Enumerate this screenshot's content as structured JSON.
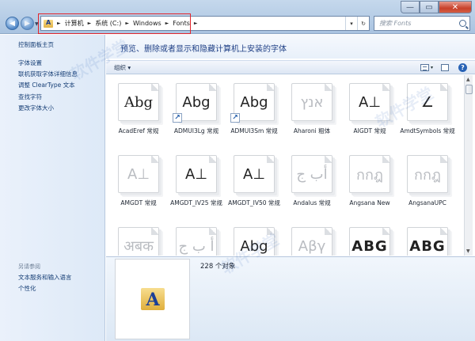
{
  "window": {
    "minimize_glyph": "—",
    "maximize_glyph": "▭",
    "close_glyph": "✕"
  },
  "address_bar": {
    "breadcrumbs": [
      "计算机",
      "系统 (C:)",
      "Windows",
      "Fonts"
    ],
    "separator": "►",
    "refresh_glyph": "↻"
  },
  "search": {
    "placeholder": "搜索 Fonts"
  },
  "sidebar": {
    "home": "控制面板主页",
    "links": [
      "字体设置",
      "联机获取字体详细信息",
      "调整 ClearType 文本",
      "查找字符",
      "更改字体大小"
    ],
    "see_also_heading": "另请参阅",
    "see_also_links": [
      "文本服务和输入语言",
      "个性化"
    ]
  },
  "header": {
    "title": "预览、删除或者显示和隐藏计算机上安装的字体"
  },
  "toolbar": {
    "organize": "组织 ▾",
    "dropdown_glyph": "▾",
    "help_glyph": "?"
  },
  "fonts": [
    {
      "name": "AcadEref 常规",
      "sample": "Abg",
      "faded": false,
      "shortcut": false
    },
    {
      "name": "ADMUI3Lg 常规",
      "sample": "Abg",
      "faded": false,
      "shortcut": true
    },
    {
      "name": "ADMUI3Sm 常规",
      "sample": "Abg",
      "faded": false,
      "shortcut": true
    },
    {
      "name": "Aharoni 粗体",
      "sample": "אנץ",
      "faded": true,
      "shortcut": false
    },
    {
      "name": "AIGDT 常规",
      "sample": "A⊥",
      "faded": false,
      "shortcut": false
    },
    {
      "name": "AmdtSymbols 常规",
      "sample": "∠",
      "faded": false,
      "shortcut": false
    },
    {
      "name": "AMGDT 常规",
      "sample": "A⊥",
      "faded": true,
      "shortcut": false
    },
    {
      "name": "AMGDT_IV25 常规",
      "sample": "A⊥",
      "faded": false,
      "shortcut": false
    },
    {
      "name": "AMGDT_IV50 常规",
      "sample": "A⊥",
      "faded": false,
      "shortcut": false
    },
    {
      "name": "Andalus 常规",
      "sample": "أب ج",
      "faded": true,
      "shortcut": false
    },
    {
      "name": "Angsana New",
      "sample": "กกฎ",
      "faded": true,
      "shortcut": false
    },
    {
      "name": "AngsanaUPC",
      "sample": "กกฎ",
      "faded": true,
      "shortcut": false
    },
    {
      "name": "",
      "sample": "अबक",
      "faded": true,
      "shortcut": false
    },
    {
      "name": "",
      "sample": "أ ب ج",
      "faded": true,
      "shortcut": false
    },
    {
      "name": "",
      "sample": "Abg",
      "faded": false,
      "shortcut": false
    },
    {
      "name": "",
      "sample": "Αβγ",
      "faded": true,
      "shortcut": false
    },
    {
      "name": "",
      "sample": "ABG",
      "faded": false,
      "shortcut": false
    },
    {
      "name": "",
      "sample": "ABG",
      "faded": false,
      "shortcut": false
    }
  ],
  "details": {
    "count_text": "228 个对象"
  },
  "watermark": "软件学堂"
}
